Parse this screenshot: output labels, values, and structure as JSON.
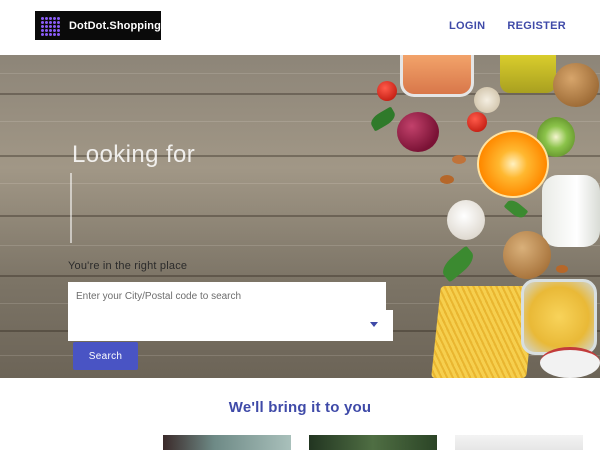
{
  "header": {
    "logo_text": "DotDot.Shopping",
    "nav": [
      {
        "label": "LOGIN"
      },
      {
        "label": "REGISTER"
      }
    ]
  },
  "hero": {
    "heading": "Looking for",
    "subtext": "You're in the right place",
    "search": {
      "placeholder": "Enter your City/Postal code to search",
      "select_value": "",
      "button_label": "Search"
    }
  },
  "section": {
    "title": "We'll bring it to you"
  },
  "colors": {
    "accent": "#3f4aa8",
    "button": "#4954c4",
    "logo_bg": "#0a0a0a",
    "logo_dots": "#8a5cf6"
  },
  "icons": {
    "logo": "dot-grid-logo-icon",
    "dropdown": "caret-down-icon"
  }
}
